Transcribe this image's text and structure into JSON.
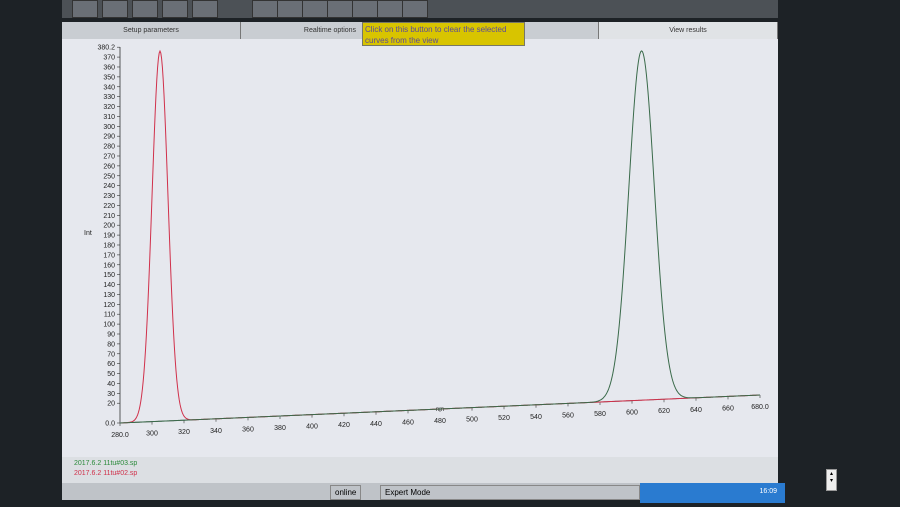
{
  "tabs": [
    {
      "label": "Setup parameters"
    },
    {
      "label": "Realtime options"
    },
    {
      "label": ""
    },
    {
      "label": "View results"
    }
  ],
  "tooltip": {
    "line1": "Click on this button to clear the selected",
    "line2": "curves from the view"
  },
  "legend": [
    {
      "label": "2017.6.2 11tu#03.sp",
      "color": "#2a8a3a"
    },
    {
      "label": "2017.6.2 11tu#02.sp",
      "color": "#d0304a"
    }
  ],
  "status": {
    "connection": "online",
    "mode": "Expert Mode"
  },
  "taskbar": {
    "clock": "16:09"
  },
  "chart_data": {
    "type": "line",
    "xlabel": "nm",
    "ylabel": "Int",
    "xlim": [
      280,
      680
    ],
    "ylim": [
      0,
      380.2
    ],
    "xticks": [
      280,
      300,
      320,
      340,
      360,
      380,
      400,
      420,
      440,
      460,
      480,
      500,
      520,
      540,
      560,
      580,
      600,
      620,
      640,
      660,
      680
    ],
    "xtick_labels": [
      "280.0",
      "300",
      "320",
      "340",
      "360",
      "380",
      "400",
      "420",
      "440",
      "460",
      "480",
      "500",
      "520",
      "540",
      "560",
      "580",
      "600",
      "620",
      "640",
      "660",
      "680.0"
    ],
    "ytop_label": "380.2",
    "yzero_label": "0.0",
    "series": [
      {
        "name": "2017.6.2 11tu#02.sp",
        "color": "#d0304a",
        "peak_x": 305,
        "peak_y": 376,
        "sigma": 5
      },
      {
        "name": "2017.6.2 11tu#03.sp",
        "color": "#3a6a4a",
        "peak_x": 606,
        "peak_y": 376,
        "sigma": 8
      }
    ]
  }
}
